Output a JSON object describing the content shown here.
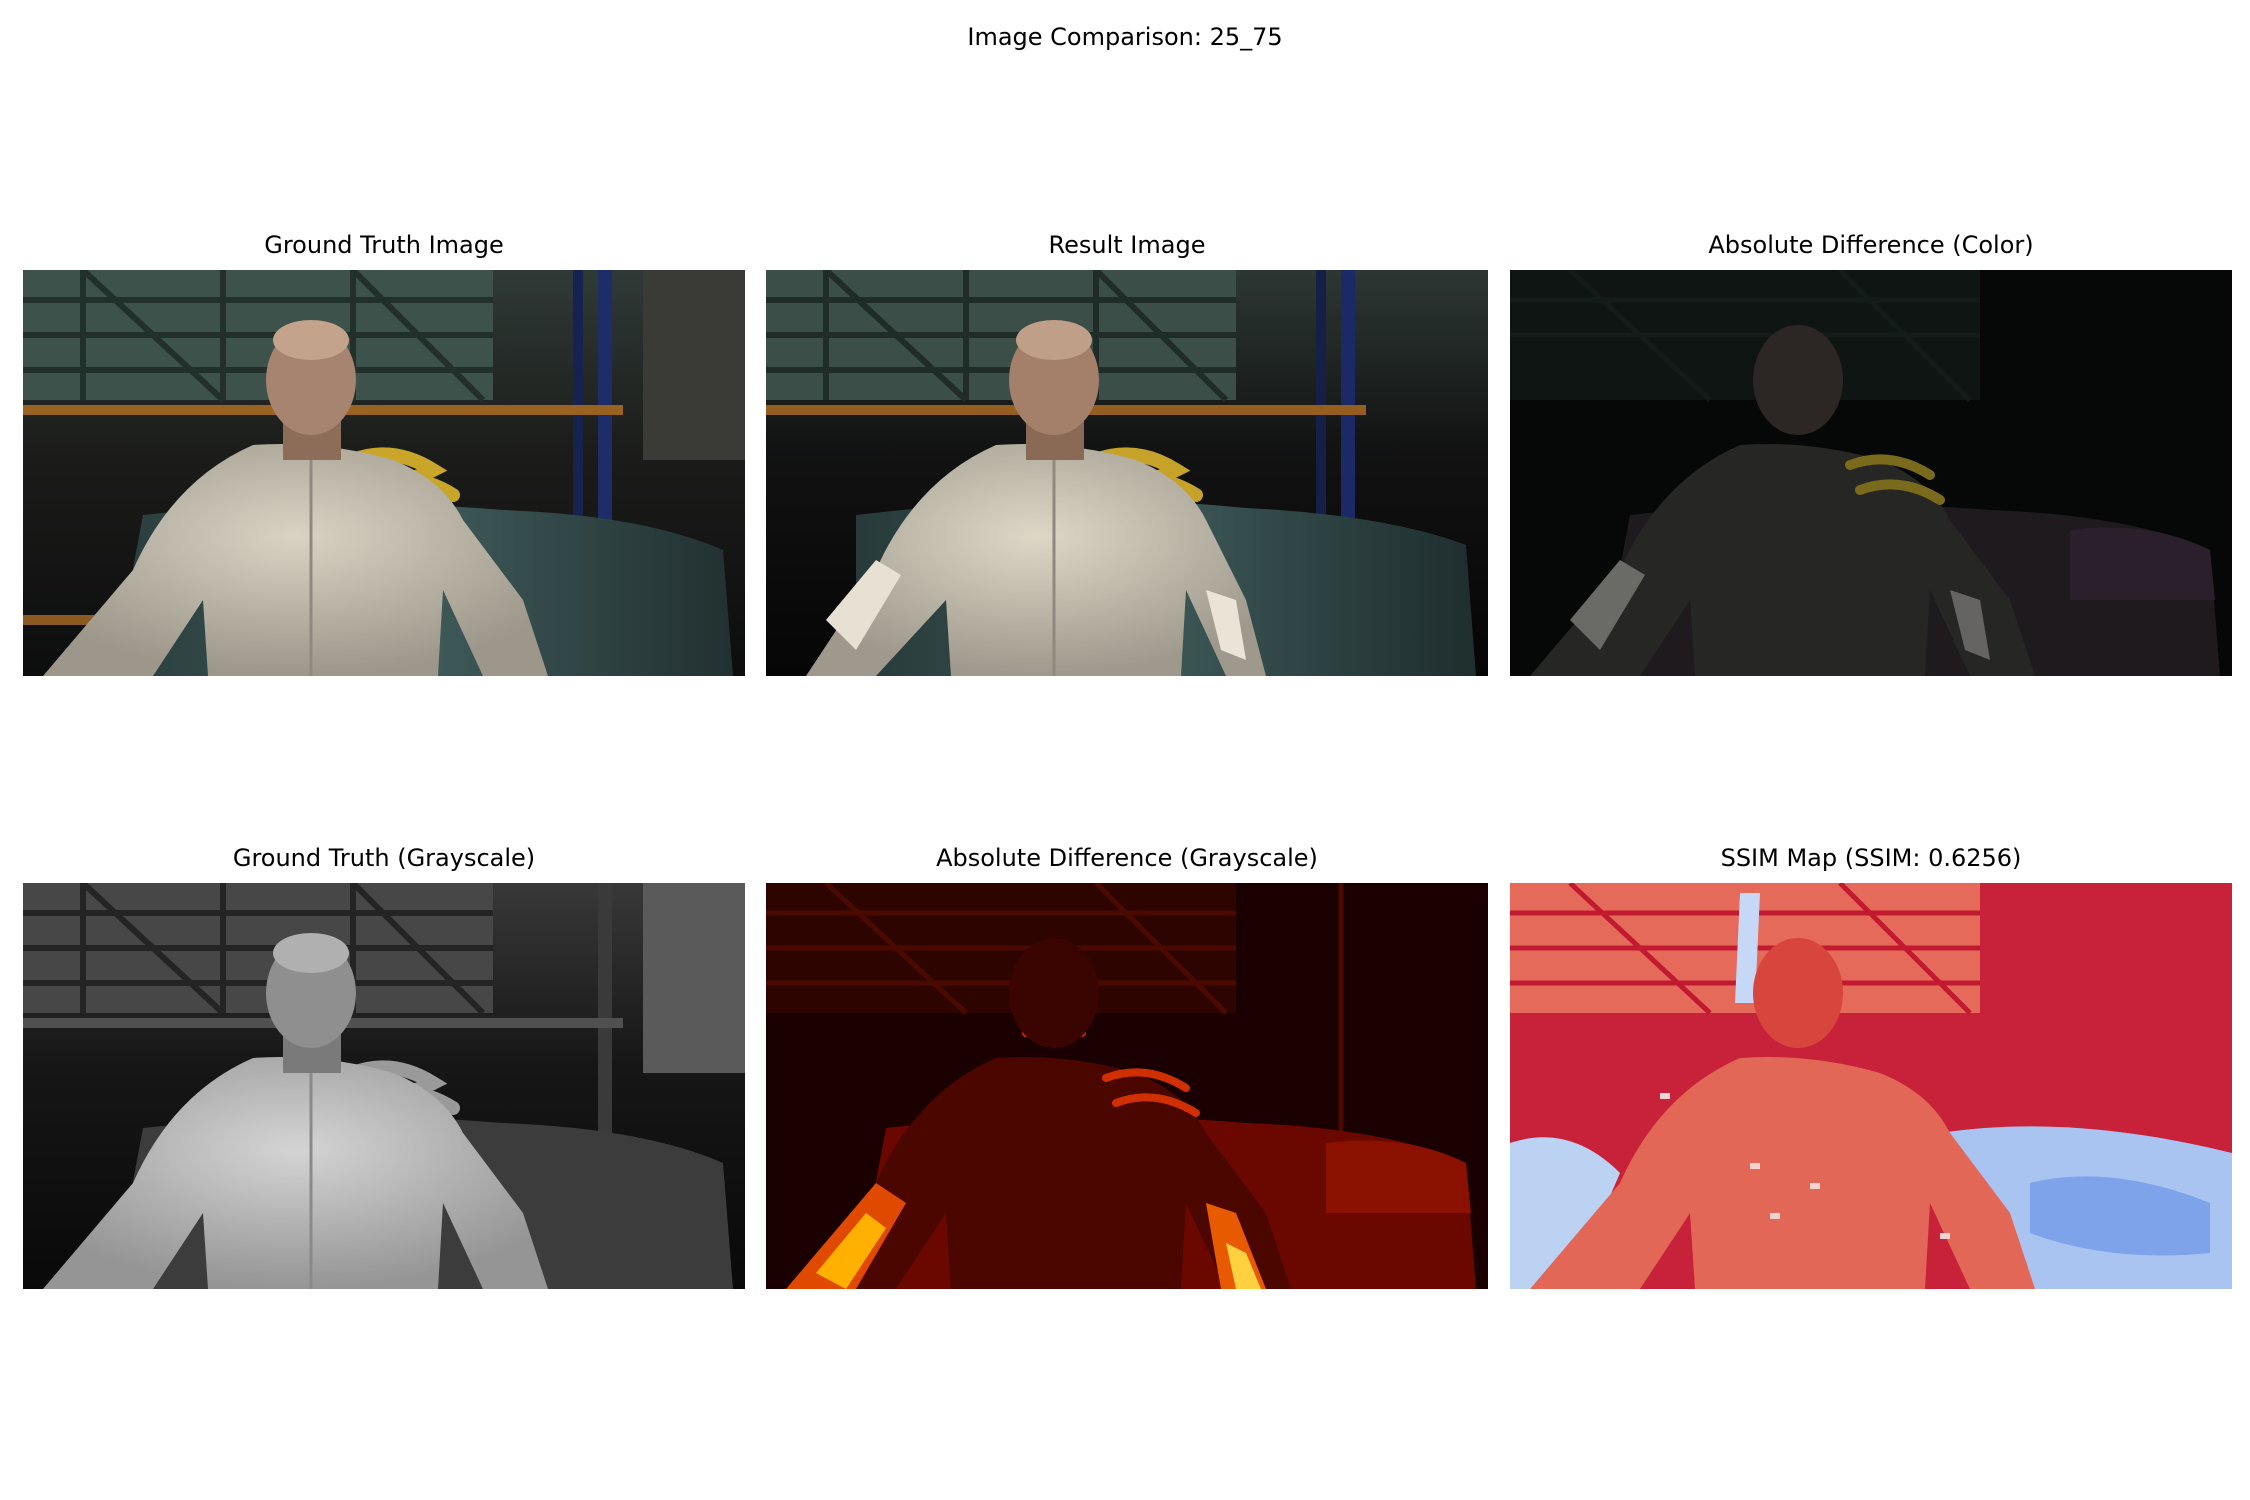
{
  "figure": {
    "title": "Image Comparison: 25_75"
  },
  "panels": {
    "ground_truth": {
      "title": "Ground Truth Image"
    },
    "result": {
      "title": "Result Image"
    },
    "abs_diff_color": {
      "title": "Absolute Difference (Color)"
    },
    "ground_truth_gray": {
      "title": "Ground Truth (Grayscale)"
    },
    "abs_diff_gray": {
      "title": "Absolute Difference (Grayscale)"
    },
    "ssim_map": {
      "title": "SSIM Map (SSIM: 0.6256)"
    }
  }
}
